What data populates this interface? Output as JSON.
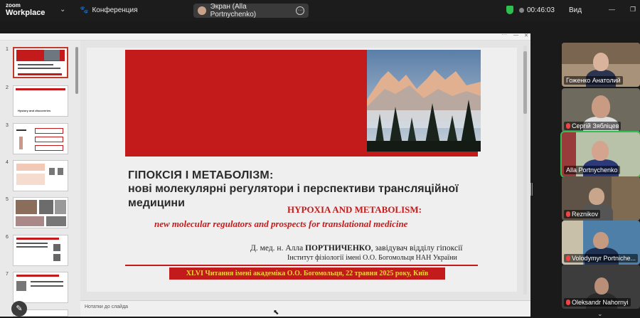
{
  "app": {
    "logo_line1": "zoom",
    "logo_line2": "Workplace",
    "conference_label": "Конференция"
  },
  "share": {
    "label": "Экран (Alla Portnychenko)",
    "more": "···"
  },
  "meeting": {
    "timer": "00:46:03",
    "view_label": "Вид"
  },
  "colors": {
    "accent_red": "#c31b1b",
    "event_text": "#f4d13a",
    "secure_green": "#2fbf4e"
  },
  "thumbnails": [
    {
      "num": "1"
    },
    {
      "num": "2",
      "caption": "Hystory and discoveries"
    },
    {
      "num": "3"
    },
    {
      "num": "4"
    },
    {
      "num": "5"
    },
    {
      "num": "6"
    },
    {
      "num": "7"
    }
  ],
  "slide": {
    "ua_line1": "ГІПОКСІЯ І МЕТАБОЛІЗМ:",
    "ua_line2": "нові молекулярні регулятори і перспективи трансляційної",
    "ua_line3": "медицини",
    "en_title": "HYPOXIA AND METABOLISM:",
    "en_subtitle": "new molecular regulators and prospects for translational medicine",
    "author_prefix": "Д. мед. н. Алла ",
    "author_name": "ПОРТНИЧЕНКО",
    "author_role": ", завідувач відділу гіпоксії",
    "institute": "Інститут фізіології імені О.О. Богомольця НАН України",
    "event": "XLVI Читання імені академіка О.О. Богомольця, 22 травня 2025 року, Київ"
  },
  "notes_label": "Нотатки до слайда",
  "participants": [
    {
      "name": "Гоженко Анатолий",
      "muted": false
    },
    {
      "name": "Сергій Зябліцев",
      "muted": true
    },
    {
      "name": "Alla Portnychenko",
      "muted": false
    },
    {
      "name": "Reznikov",
      "muted": true
    },
    {
      "name": "Volodymyr Portniche...",
      "muted": true
    },
    {
      "name": "Oleksandr Nahornyi",
      "muted": true
    }
  ]
}
